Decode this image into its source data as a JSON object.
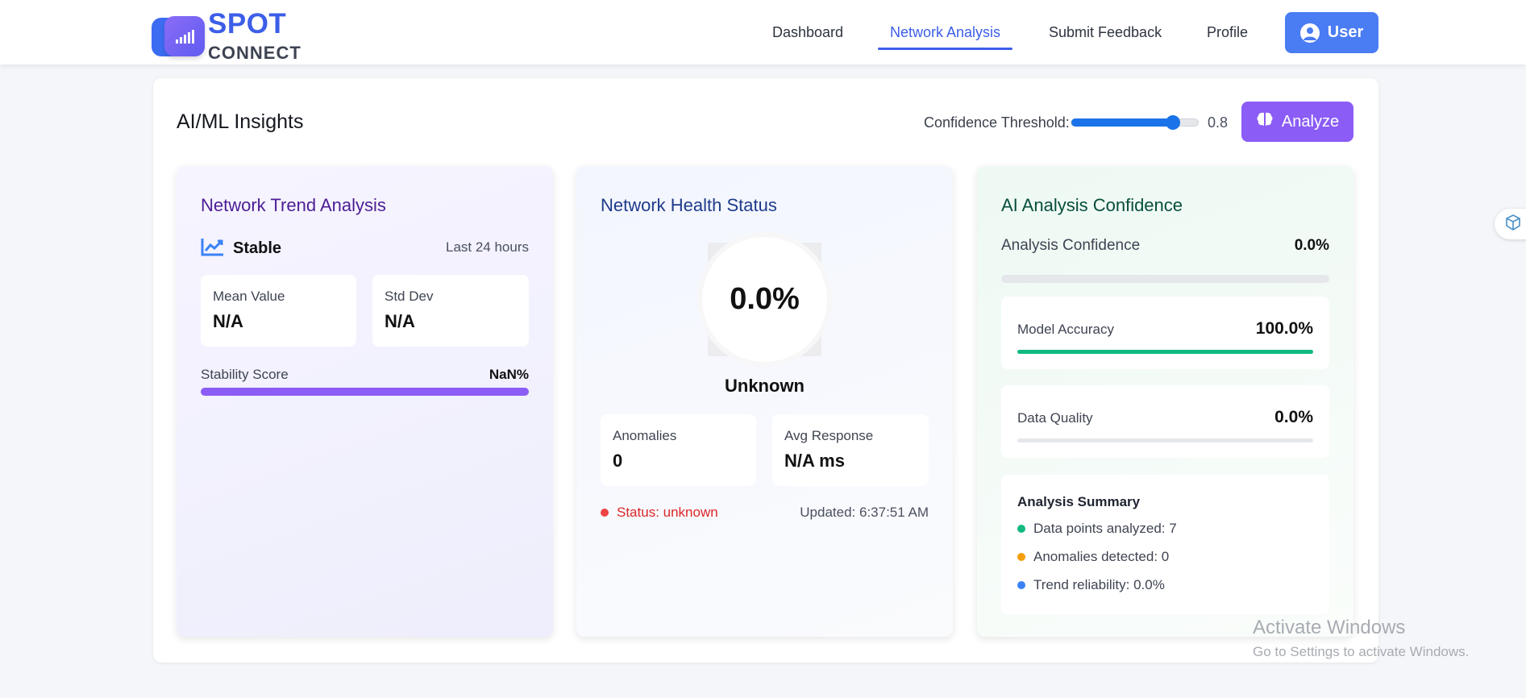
{
  "brand": {
    "line1": "SPOT",
    "line2": "CONNECT"
  },
  "nav": {
    "links": [
      {
        "label": "Dashboard"
      },
      {
        "label": "Network Analysis"
      },
      {
        "label": "Submit Feedback"
      },
      {
        "label": "Profile"
      }
    ],
    "active": "Network Analysis",
    "user_label": "User"
  },
  "panel": {
    "title": "AI/ML Insights",
    "threshold_label": "Confidence Threshold:",
    "threshold_value": "0.8",
    "threshold_fraction": 0.8,
    "analyze_label": "Analyze"
  },
  "trend": {
    "title": "Network Trend Analysis",
    "status": "Stable",
    "period": "Last 24 hours",
    "mean_label": "Mean Value",
    "mean_value": "N/A",
    "std_label": "Std Dev",
    "std_value": "N/A",
    "stability_label": "Stability Score",
    "stability_value": "NaN%",
    "stability_fill": 1.0
  },
  "health": {
    "title": "Network Health Status",
    "score": "0.0%",
    "state": "Unknown",
    "anomalies_label": "Anomalies",
    "anomalies_value": "0",
    "avg_label": "Avg Response",
    "avg_value": "N/A ms",
    "status_text": "Status: unknown",
    "updated_text": "Updated: 6:37:51 AM"
  },
  "confidence": {
    "title": "AI Analysis Confidence",
    "analysis_label": "Analysis Confidence",
    "analysis_value": "0.0%",
    "analysis_fill": 0.0,
    "model_label": "Model Accuracy",
    "model_value": "100.0%",
    "model_fill": 1.0,
    "quality_label": "Data Quality",
    "quality_value": "0.0%",
    "quality_fill": 0.0,
    "summary_title": "Analysis Summary",
    "summary": [
      {
        "text": "Data points analyzed: 7",
        "color": "#10b981"
      },
      {
        "text": "Anomalies detected: 0",
        "color": "#f59e0b"
      },
      {
        "text": "Trend reliability: 0.0%",
        "color": "#3b82f6"
      }
    ]
  },
  "watermark": {
    "line1": "Activate Windows",
    "line2": "Go to Settings to activate Windows."
  },
  "colors": {
    "accent": "#3c5ee8",
    "purple": "#8b5cf6",
    "green": "#10b981",
    "danger": "#ef4444"
  },
  "icons": [
    "signal-bars-icon",
    "user-circle-icon",
    "brain-icon",
    "trending-chart-icon",
    "cube-icon"
  ]
}
